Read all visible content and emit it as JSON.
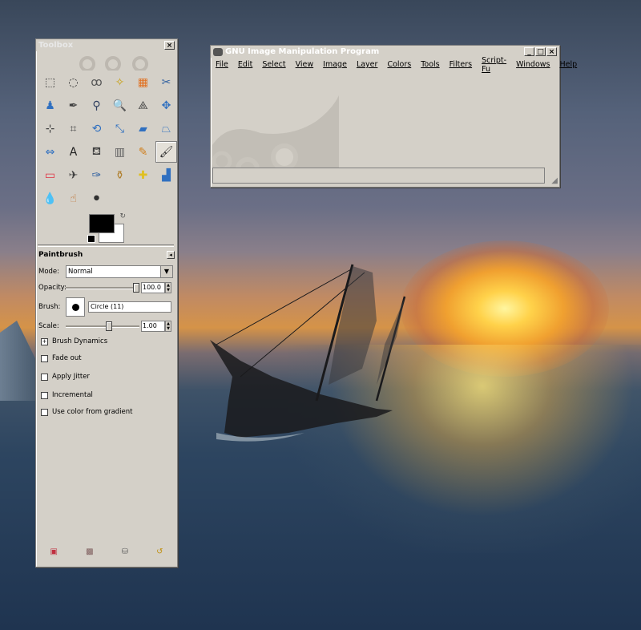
{
  "desktop": {
    "wallpaper": "sunset-sea-ship"
  },
  "toolbox": {
    "title": "Toolbox",
    "close_glyph": "×",
    "tools": [
      {
        "name": "rect-select-icon",
        "glyph": "⬚",
        "color": "#333"
      },
      {
        "name": "ellipse-select-icon",
        "glyph": "◌",
        "color": "#333"
      },
      {
        "name": "free-select-icon",
        "glyph": "ꝏ",
        "color": "#555"
      },
      {
        "name": "fuzzy-select-icon",
        "glyph": "✧",
        "color": "#c8a010"
      },
      {
        "name": "color-select-icon",
        "glyph": "▦",
        "color": "#e07020"
      },
      {
        "name": "scissors-icon",
        "glyph": "✂",
        "color": "#3060a0"
      },
      {
        "name": "foreground-select-icon",
        "glyph": "♟",
        "color": "#3070c0"
      },
      {
        "name": "paths-icon",
        "glyph": "✒",
        "color": "#404040"
      },
      {
        "name": "color-picker-icon",
        "glyph": "⚲",
        "color": "#304060"
      },
      {
        "name": "zoom-icon",
        "glyph": "🔍",
        "color": "#3060a0"
      },
      {
        "name": "measure-icon",
        "glyph": "⟁",
        "color": "#404040"
      },
      {
        "name": "move-icon",
        "glyph": "✥",
        "color": "#3070c0"
      },
      {
        "name": "align-icon",
        "glyph": "⊹",
        "color": "#404040"
      },
      {
        "name": "crop-icon",
        "glyph": "⌗",
        "color": "#505050"
      },
      {
        "name": "rotate-icon",
        "glyph": "⟲",
        "color": "#3070c0"
      },
      {
        "name": "scale-icon",
        "glyph": "⤡",
        "color": "#3070c0"
      },
      {
        "name": "shear-icon",
        "glyph": "▰",
        "color": "#3070c0"
      },
      {
        "name": "perspective-icon",
        "glyph": "⏢",
        "color": "#3070c0"
      },
      {
        "name": "flip-icon",
        "glyph": "⇔",
        "color": "#3070c0"
      },
      {
        "name": "text-icon",
        "glyph": "A",
        "color": "#202020"
      },
      {
        "name": "bucket-fill-icon",
        "glyph": "⛾",
        "color": "#404040"
      },
      {
        "name": "blend-icon",
        "glyph": "▥",
        "color": "#606060"
      },
      {
        "name": "pencil-icon",
        "glyph": "✎",
        "color": "#d08020"
      },
      {
        "name": "paintbrush-icon",
        "glyph": "🖌",
        "color": "#303030"
      },
      {
        "name": "eraser-icon",
        "glyph": "▭",
        "color": "#e03040"
      },
      {
        "name": "airbrush-icon",
        "glyph": "✈",
        "color": "#404040"
      },
      {
        "name": "ink-icon",
        "glyph": "✑",
        "color": "#3060a0"
      },
      {
        "name": "clone-icon",
        "glyph": "⚱",
        "color": "#b08030"
      },
      {
        "name": "heal-icon",
        "glyph": "✚",
        "color": "#e0c020"
      },
      {
        "name": "perspective-clone-icon",
        "glyph": "▟",
        "color": "#3070c0"
      },
      {
        "name": "blur-icon",
        "glyph": "💧",
        "color": "#3070c0"
      },
      {
        "name": "smudge-icon",
        "glyph": "☝",
        "color": "#c07030"
      },
      {
        "name": "dodge-burn-icon",
        "glyph": "⚫",
        "color": "#303030"
      }
    ],
    "active_tool_index": 23,
    "bottom_icons": [
      {
        "name": "save-options-icon",
        "glyph": "▣",
        "color": "#c03040"
      },
      {
        "name": "restore-options-icon",
        "glyph": "▩",
        "color": "#806060"
      },
      {
        "name": "delete-options-icon",
        "glyph": "⛁",
        "color": "#606060"
      },
      {
        "name": "reset-options-icon",
        "glyph": "↺",
        "color": "#c09010"
      }
    ]
  },
  "tool_options": {
    "title": "Paintbrush",
    "mode_label": "Mode:",
    "mode_value": "Normal",
    "opacity_label": "Opacity:",
    "opacity_value": "100.0",
    "opacity_fraction": 1.0,
    "brush_label": "Brush:",
    "brush_name": "Circle (11)",
    "scale_label": "Scale:",
    "scale_value": "1.00",
    "scale_fraction": 0.6,
    "brush_dynamics": "Brush Dynamics",
    "fade_out": "Fade out",
    "apply_jitter": "Apply Jitter",
    "incremental": "Incremental",
    "use_color_gradient": "Use color from gradient"
  },
  "main_window": {
    "title": "GNU Image Manipulation Program",
    "menu": [
      "File",
      "Edit",
      "Select",
      "View",
      "Image",
      "Layer",
      "Colors",
      "Tools",
      "Filters",
      "Script-Fu",
      "Windows",
      "Help"
    ]
  }
}
